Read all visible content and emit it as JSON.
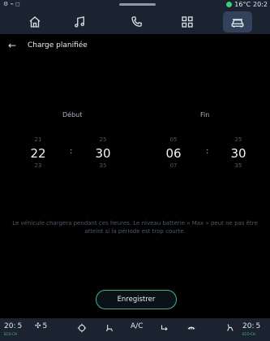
{
  "status": {
    "time": "20:2",
    "temperature": "16°C"
  },
  "nav": {
    "items": [
      {
        "name": "home",
        "icon": "home-icon"
      },
      {
        "name": "music",
        "icon": "music-icon"
      },
      {
        "name": "phone",
        "icon": "phone-icon"
      },
      {
        "name": "apps",
        "icon": "apps-icon"
      },
      {
        "name": "vehicle",
        "icon": "car-icon"
      }
    ],
    "active": "vehicle"
  },
  "page": {
    "back_icon": "back-icon",
    "title": "Charge planifiée"
  },
  "schedule": {
    "start_label": "Début",
    "end_label": "Fin",
    "start": {
      "hour": {
        "prev": "21",
        "current": "22",
        "next": "23"
      },
      "minute": {
        "prev": "25",
        "current": "30",
        "next": "35"
      }
    },
    "end": {
      "hour": {
        "prev": "05",
        "current": "06",
        "next": "07"
      },
      "minute": {
        "prev": "25",
        "current": "30",
        "next": "35"
      }
    }
  },
  "note": "Le véhicule chargera pendant ces heures. Le niveau batterie « Max » peut ne pas être atteint si la période est trop courte.",
  "save_label": "Enregistrer",
  "bottom": {
    "left_temp": "20:",
    "left_temp_small": "5",
    "left_eco": "ECO-CH",
    "fan_level": "5",
    "ac_label": "A/C",
    "right_temp": "20:",
    "right_temp_small": "5",
    "right_eco": "ECO-CH"
  },
  "colors": {
    "accent": "#4ab37f",
    "panel": "#1b2230",
    "active_tab": "#33425a"
  }
}
